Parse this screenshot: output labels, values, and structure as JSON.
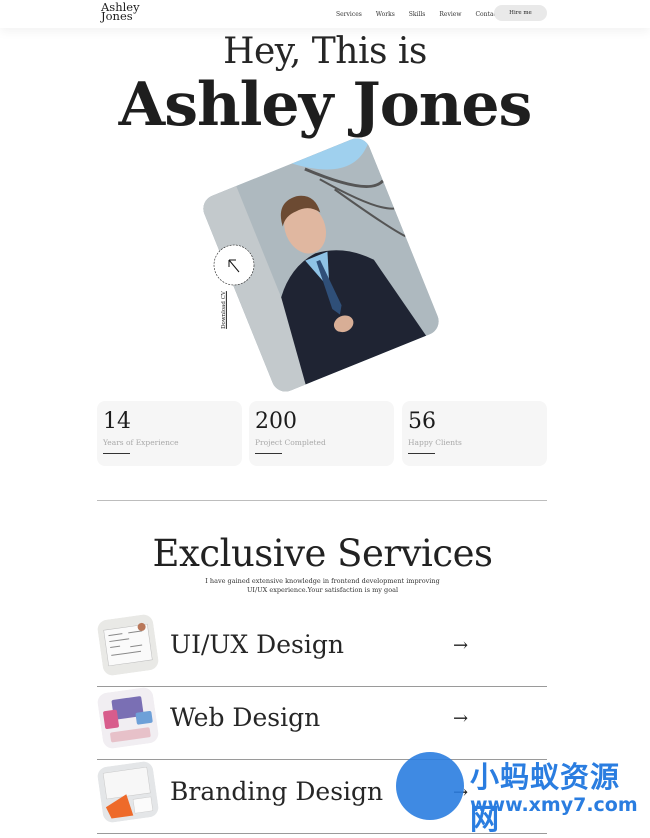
{
  "nav": {
    "logo_line1": "Ashley",
    "logo_line2": "Jones",
    "items": [
      "Services",
      "Works",
      "Skills",
      "Review",
      "Contact"
    ],
    "hire_label": "Hire me"
  },
  "hero": {
    "greeting": "Hey, This is",
    "name": "Ashley Jones",
    "download_label": "Download CV"
  },
  "stats": [
    {
      "value": "14",
      "label": "Years of Experience"
    },
    {
      "value": "200",
      "label": "Project Completed"
    },
    {
      "value": "56",
      "label": "Happy Clients"
    }
  ],
  "services": {
    "title": "Exclusive Services",
    "description": "I have gained extensive knowledge in frontend development improving UI/UX experience.Your satisfaction is my goal",
    "items": [
      {
        "title": "UI/UX Design",
        "icon": "arrow-right-icon"
      },
      {
        "title": "Web Design",
        "icon": "arrow-right-icon"
      },
      {
        "title": "Branding Design",
        "icon": "arrow-right-icon"
      }
    ]
  },
  "watermark": {
    "line1": "小蚂蚁资源网",
    "line2": "www.xmy7.com"
  },
  "colors": {
    "accent": "#2a7de0",
    "card_bg": "#f6f6f6",
    "text": "#1d1d1d"
  }
}
